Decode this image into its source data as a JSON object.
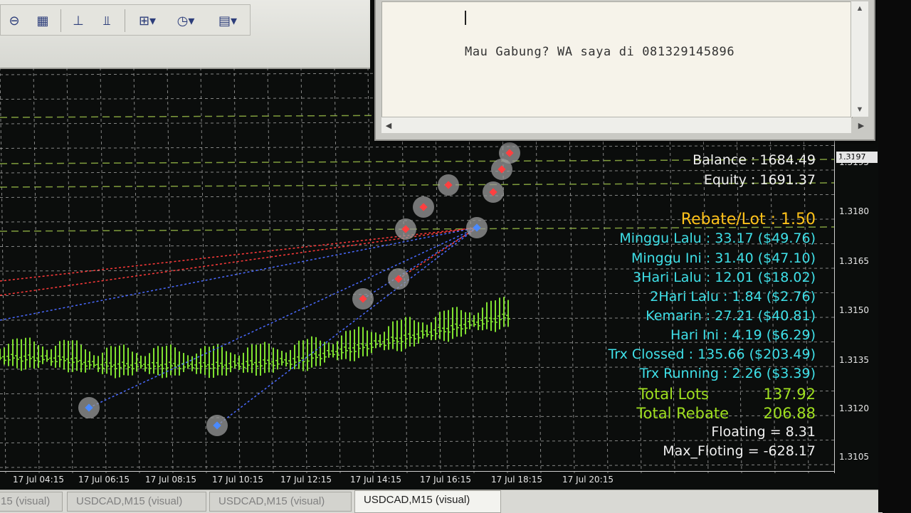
{
  "toolbar": {
    "icons": [
      "zoom-out-icon",
      "tile-windows-icon",
      "chart-shift-icon",
      "auto-scroll-icon",
      "indicators-icon",
      "periods-clock-icon",
      "templates-icon"
    ]
  },
  "popup": {
    "message": "Mau Gabung? WA saya di 081329145896"
  },
  "colors": {
    "grid": "#b8b8b8",
    "candle": "#7fe030",
    "cyan": "#3fe0e8",
    "yellow": "#ffc21a",
    "green_label": "#a0e020",
    "white": "#f0f0f0"
  },
  "stats": {
    "balance": "Balance : 1684.49",
    "equity": "Equity : 1691.37",
    "rebate_lot": "Rebate/Lot : 1.50",
    "minggu_lalu": "Minggu Lalu  : 33.17  ($49.76)",
    "minggu_ini": "Minggu Ini  : 31.40  ($47.10)",
    "hari3_lalu": "3Hari Lalu  : 12.01  ($18.02)",
    "hari2_lalu": "2Hari Lalu  : 1.84  ($2.76)",
    "kemarin": "Kemarin  : 27.21  ($40.81)",
    "hari_ini": "Hari Ini  : 4.19  ($6.29)",
    "trx_closed": "Trx Clossed : 135.66  ($203.49)",
    "trx_running": "Trx Running  : 2.26  ($3.39)",
    "total_lots_label": "Total Lots",
    "total_lots_value": "137.92",
    "total_rebate_label": "Total Rebate",
    "total_rebate_value": "206.88",
    "floating": "Floating = 8.31",
    "max_floting": "Max_Floting  = -628.17"
  },
  "price_axis": {
    "ticks": [
      "1.3195",
      "1.3180",
      "1.3165",
      "1.3150",
      "1.3135",
      "1.3120",
      "1.3105"
    ],
    "current": "1.3197"
  },
  "time_axis": {
    "ticks": [
      "17 Jul 04:15",
      "17 Jul 06:15",
      "17 Jul 08:15",
      "17 Jul 10:15",
      "17 Jul 12:15",
      "17 Jul 14:15",
      "17 Jul 16:15",
      "17 Jul 18:15",
      "17 Jul 20:15"
    ]
  },
  "tabs": [
    "15 (visual)",
    "USDCAD,M15 (visual)",
    "USDCAD,M15 (visual)",
    "USDCAD,M15 (visual)"
  ]
}
